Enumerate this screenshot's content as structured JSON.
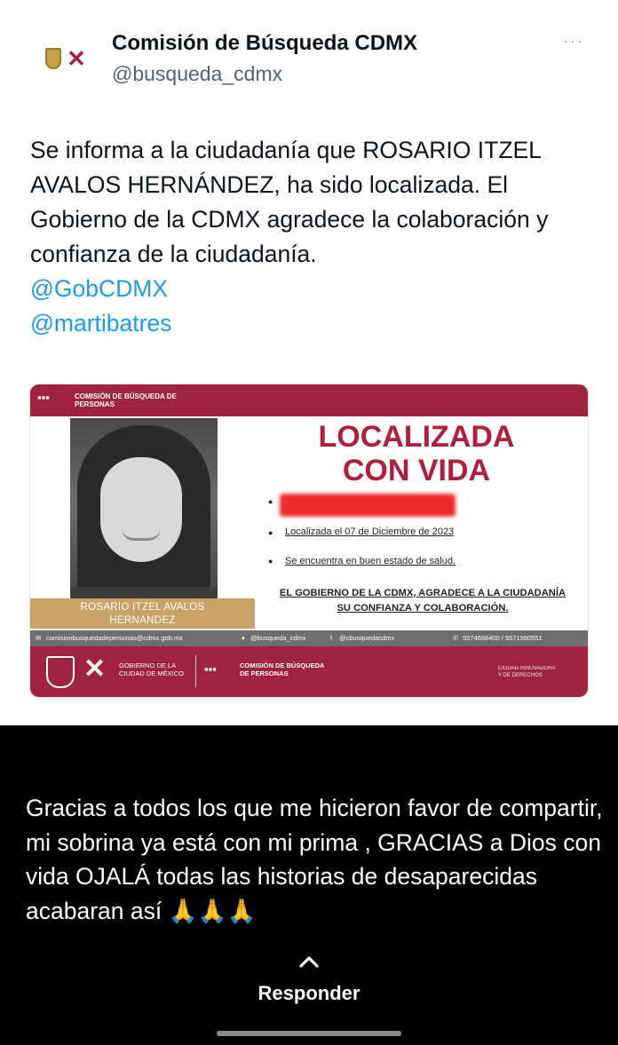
{
  "tweet": {
    "account_name": "Comisión de Búsqueda CDMX",
    "account_handle": "@busqueda_cdmx",
    "more_label": "···",
    "text": "Se informa a la ciudadanía que ROSARIO ITZEL AVALOS HERNÁNDEZ, ha sido localizada. El Gobierno de la CDMX agradece la colaboración y confianza de la ciudadanía.",
    "mentions": [
      "@GobCDMX",
      "@martibatres"
    ]
  },
  "card": {
    "org_top": "COMISIÓN DE BÚSQUEDA DE PERSONAS",
    "headline_line1": "LOCALIZADA",
    "headline_line2": "CON VIDA",
    "bullet_date": "Localizada el 07 de Diciembre de 2023",
    "bullet_health": "Se encuentra en buen estado de salud.",
    "thanks_line1": "EL GOBIERNO DE LA CDMX, AGRADECE A LA CIUDADANÍA",
    "thanks_line2": "SU CONFIANZA Y COLABORACIÓN.",
    "person_name_line1": "ROSARIO ITZEL AVALOS",
    "person_name_line2": "HERNANDEZ",
    "contact_email": "comisionbusquedadepersonas@cdmx.gob.mx",
    "contact_twitter": "@busqueda_cdmx",
    "contact_facebook": "@cbusquedacdmx",
    "contact_phones": "5574688400 / 5571980551",
    "gob_line1": "GOBIERNO DE LA",
    "gob_line2": "CIUDAD DE MÉXICO",
    "org_bottom_line1": "COMISIÓN DE BÚSQUEDA",
    "org_bottom_line2": "DE PERSONAS",
    "slogan_line1": "CIUDAD INNOVADORA",
    "slogan_line2": "Y DE DERECHOS"
  },
  "story": {
    "text": "Gracias a todos los que me hicieron favor de compartir, mi sobrina ya está con mi prima , GRACIAS a Dios con vida OJALÁ todas las historias de desaparecidas acabaran así 🙏🙏🙏",
    "reply_label": "Responder"
  },
  "colors": {
    "brand_wine": "#9f2241",
    "headline_red": "#b01e3c",
    "link_blue": "#1d9bf0",
    "gold": "#c9a265"
  },
  "icons": [
    "more-icon",
    "chevron-up-icon",
    "mail-icon",
    "twitter-icon",
    "facebook-icon",
    "phone-icon"
  ]
}
